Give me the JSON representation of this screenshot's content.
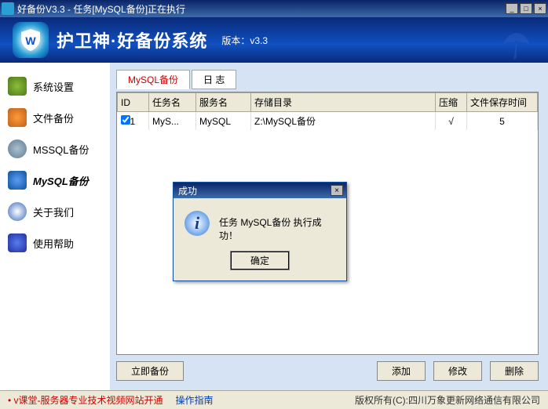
{
  "window": {
    "title": "好备份V3.3 - 任务[MySQL备份]正在执行"
  },
  "header": {
    "app_title": "护卫神·好备份系统",
    "version_label": "版本：v3.3"
  },
  "sidebar": {
    "items": [
      {
        "label": "系统设置"
      },
      {
        "label": "文件备份"
      },
      {
        "label": "MSSQL备份"
      },
      {
        "label": "MySQL备份"
      },
      {
        "label": "关于我们"
      },
      {
        "label": "使用帮助"
      }
    ]
  },
  "tabs": [
    {
      "label": "MySQL备份",
      "active": true
    },
    {
      "label": "日 志",
      "active": false
    }
  ],
  "table": {
    "headers": {
      "id": "ID",
      "task": "任务名",
      "service": "服务名",
      "storage": "存储目录",
      "compress": "压缩",
      "retention": "文件保存时间"
    },
    "rows": [
      {
        "id": "1",
        "task": "MyS...",
        "service": "MySQL",
        "storage": "Z:\\MySQL备份",
        "compress": "√",
        "retention": "5"
      }
    ]
  },
  "buttons": {
    "backup_now": "立即备份",
    "add": "添加",
    "edit": "修改",
    "delete": "删除"
  },
  "footer": {
    "link1": "v课堂-服务器专业技术视频网站开通",
    "link2": "操作指南",
    "copyright": "版权所有(C):四川万象更新网络通信有限公司"
  },
  "dialog": {
    "title": "成功",
    "message": "任务 MySQL备份 执行成功！",
    "ok": "确定"
  }
}
